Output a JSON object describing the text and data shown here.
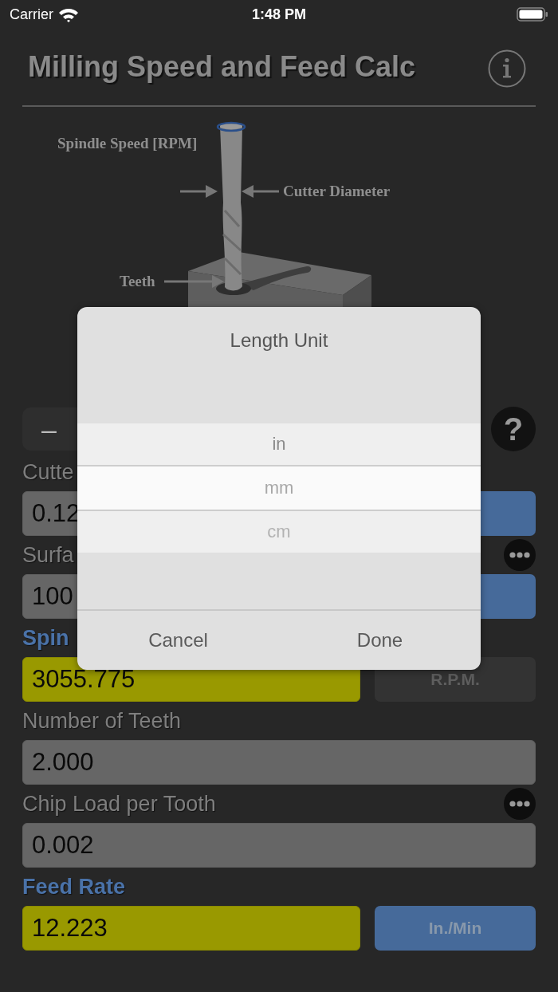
{
  "status_bar": {
    "carrier": "Carrier",
    "time": "1:48 PM"
  },
  "title": "Milling Speed and Feed Calc",
  "diagram": {
    "labels": [
      {
        "kind": "spindle",
        "text": "Spindle Speed [RPM]"
      },
      {
        "kind": "diameter",
        "text": "Cutter Diameter"
      },
      {
        "kind": "teeth",
        "text": "Teeth"
      }
    ]
  },
  "mode_button": "–",
  "help_button": "?",
  "fields": [
    {
      "kind": "unit",
      "label": "Cutte",
      "value": "0.12",
      "unit_active": true,
      "menu": false
    },
    {
      "kind": "unit",
      "label": "Surfa",
      "value": "100",
      "unit_active": true,
      "menu": true
    },
    {
      "kind": "result",
      "label": "Spin",
      "value": "3055.775",
      "unit": "R.P.M.",
      "unit_active": false,
      "menu": false
    },
    {
      "kind": "plain",
      "label": "Number of Teeth",
      "value": "2.000",
      "menu": false
    },
    {
      "kind": "plain",
      "label": "Chip Load per Tooth",
      "value": "0.002",
      "menu": true
    },
    {
      "kind": "result",
      "label": "Feed Rate",
      "value": "12.223",
      "unit": "In./Min",
      "unit_active": true,
      "menu": false
    }
  ],
  "dialog": {
    "title": "Length Unit",
    "options": [
      {
        "label": "in",
        "selected": false
      },
      {
        "label": "mm",
        "selected": true
      },
      {
        "label": "cm",
        "selected": false
      }
    ],
    "buttons": [
      "Cancel",
      "Done"
    ]
  }
}
